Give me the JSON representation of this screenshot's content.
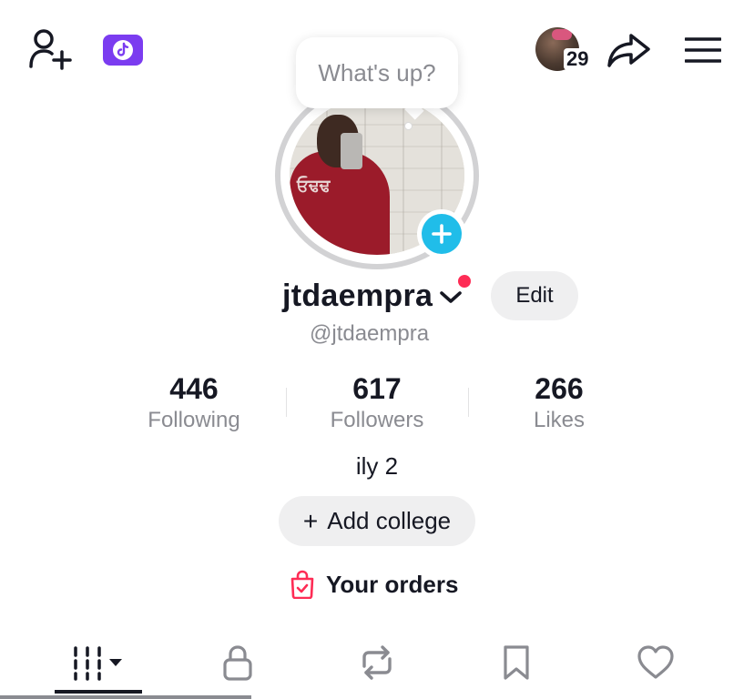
{
  "header": {
    "add_friend_icon": "person-plus-icon",
    "tiktok_badge_icon": "tiktok-logo-icon",
    "story_count": "29",
    "share_icon": "share-arrow-icon",
    "menu_icon": "hamburger-menu-icon"
  },
  "profile": {
    "bubble_text": "What's up?",
    "username": "jtdaempra",
    "handle": "@jtdaempra",
    "edit_label": "Edit",
    "add_story_icon": "plus-icon",
    "photo_text": "ਓਢਢ"
  },
  "stats": [
    {
      "value": "446",
      "label": "Following"
    },
    {
      "value": "617",
      "label": "Followers"
    },
    {
      "value": "266",
      "label": "Likes"
    }
  ],
  "bio": "ily 2",
  "college": {
    "plus": "+",
    "label": "Add college"
  },
  "orders": {
    "label": "Your orders",
    "icon": "shopping-bag-icon"
  },
  "tabs": [
    {
      "name": "videos",
      "icon": "grid-bars-icon"
    },
    {
      "name": "private",
      "icon": "lock-icon"
    },
    {
      "name": "reposts",
      "icon": "repost-icon"
    },
    {
      "name": "favorites",
      "icon": "bookmark-icon"
    },
    {
      "name": "liked",
      "icon": "heart-icon"
    }
  ],
  "colors": {
    "accent_red": "#fe2c55",
    "badge_purple": "#7b3cf0",
    "add_story_blue": "#20bde9"
  }
}
